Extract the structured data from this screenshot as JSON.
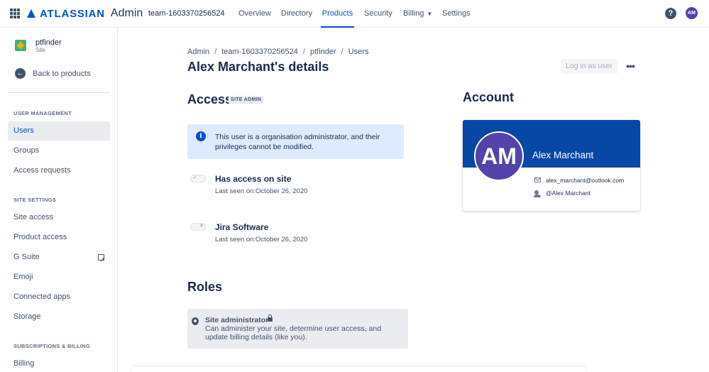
{
  "topnav": {
    "logo_text": "ATLASSIAN",
    "logo_sub": "Admin",
    "org": "team-1603370256524",
    "items": [
      {
        "label": "Overview"
      },
      {
        "label": "Directory"
      },
      {
        "label": "Products",
        "active": true
      },
      {
        "label": "Security"
      },
      {
        "label": "Billing"
      },
      {
        "label": "Settings"
      }
    ],
    "help_glyph": "?",
    "avatar_initials": "AM"
  },
  "sidebar": {
    "site_name": "ptfinder",
    "site_type": "Site",
    "back_label": "Back to products",
    "sections": {
      "user_management": "USER MANAGEMENT",
      "site_settings": "SITE SETTINGS",
      "subscriptions": "SUBSCRIPTIONS & BILLING"
    },
    "items": [
      {
        "label": "Users",
        "active": true
      },
      {
        "label": "Groups"
      },
      {
        "label": "Access requests"
      },
      {
        "label": "Site access"
      },
      {
        "label": "Product access"
      },
      {
        "label": "G Suite"
      },
      {
        "label": "Emoji"
      },
      {
        "label": "Connected apps"
      },
      {
        "label": "Storage"
      },
      {
        "label": "Billing"
      }
    ]
  },
  "breadcrumb": [
    "Admin",
    "team-1603370256524",
    "ptfinder",
    "Users"
  ],
  "page_title": "Alex Marchant's details",
  "actions": {
    "login_as": "Log in as user",
    "more": "•••"
  },
  "access": {
    "heading": "Access",
    "badge": "SITE ADMIN",
    "info": "This user is a organisation administrator, and their privileges cannot be modified.",
    "permissions": [
      {
        "title": "Has access on site",
        "subtitle": "Last seen on:October 26, 2020",
        "enabled": true
      },
      {
        "title": "Jira Software",
        "subtitle": "Last seen on:October 26, 2020",
        "enabled": false
      }
    ]
  },
  "roles": {
    "heading": "Roles",
    "items": [
      {
        "title": "Site administrator",
        "description": "Can administer your site, determine user access, and update billing details (like you)."
      }
    ]
  },
  "account": {
    "heading": "Account",
    "initials": "AM",
    "name": "Alex Marchant",
    "email": "alex_marchant@outlook.com",
    "handle": "@Alex Marchant"
  },
  "colors": {
    "brand": "#0052cc",
    "card_header": "#0747a6",
    "avatar": "#5243aa",
    "info_bg": "#deebff"
  }
}
